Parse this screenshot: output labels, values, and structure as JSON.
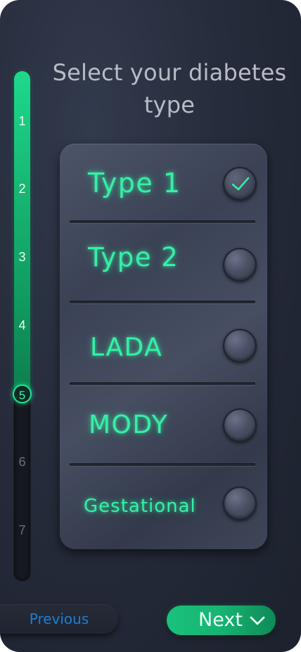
{
  "title": "Select your diabetes type",
  "progress": {
    "current_step": 5,
    "total_steps": 7,
    "steps": [
      "1",
      "2",
      "3",
      "4",
      "5",
      "6",
      "7"
    ]
  },
  "options": [
    {
      "label": "Type 1",
      "selected": true
    },
    {
      "label": "Type 2",
      "selected": false
    },
    {
      "label": "LADA",
      "selected": false
    },
    {
      "label": "MODY",
      "selected": false
    },
    {
      "label": "Gestational",
      "selected": false
    }
  ],
  "buttons": {
    "previous_label": "Previous",
    "next_label": "Next"
  },
  "icons": {
    "selected_option": "checkmark-icon",
    "next": "chevron-down-icon"
  },
  "colors": {
    "accent": "#1ed98d",
    "option_text": "#35f0a5",
    "previous_text": "#1b7fd6",
    "background": "#262c3b"
  }
}
